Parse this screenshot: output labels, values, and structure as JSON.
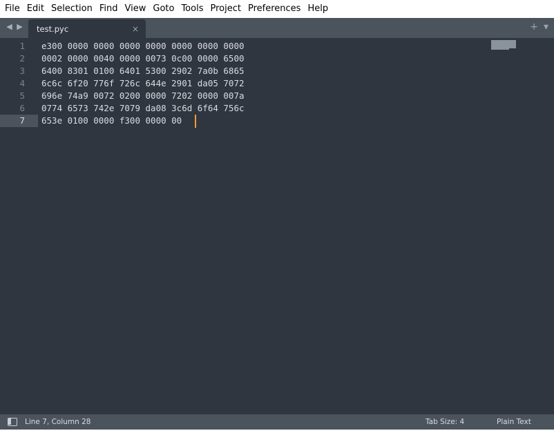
{
  "menu": [
    "File",
    "Edit",
    "Selection",
    "Find",
    "View",
    "Goto",
    "Tools",
    "Project",
    "Preferences",
    "Help"
  ],
  "tab": {
    "title": "test.pyc",
    "close": "×"
  },
  "tabbar": {
    "new_tab": "+",
    "dropdown": "▾"
  },
  "nav": {
    "back": "◀",
    "forward": "▶"
  },
  "lines": [
    {
      "num": "1",
      "code": "e300 0000 0000 0000 0000 0000 0000 0000"
    },
    {
      "num": "2",
      "code": "0002 0000 0040 0000 0073 0c00 0000 6500"
    },
    {
      "num": "3",
      "code": "6400 8301 0100 6401 5300 2902 7a0b 6865"
    },
    {
      "num": "4",
      "code": "6c6c 6f20 776f 726c 644e 2901 da05 7072"
    },
    {
      "num": "5",
      "code": "696e 74a9 0072 0200 0000 7202 0000 007a"
    },
    {
      "num": "6",
      "code": "0774 6573 742e 7079 da08 3c6d 6f64 756c"
    },
    {
      "num": "7",
      "code": "653e 0100 0000 f300 0000 00"
    }
  ],
  "status": {
    "position": "Line 7, Column 28",
    "tab_size": "Tab Size: 4",
    "syntax": "Plain Text"
  },
  "colors": {
    "editor_bg": "#2f3640",
    "tabbar_bg": "#4b535d",
    "cursor": "#f0a030"
  }
}
